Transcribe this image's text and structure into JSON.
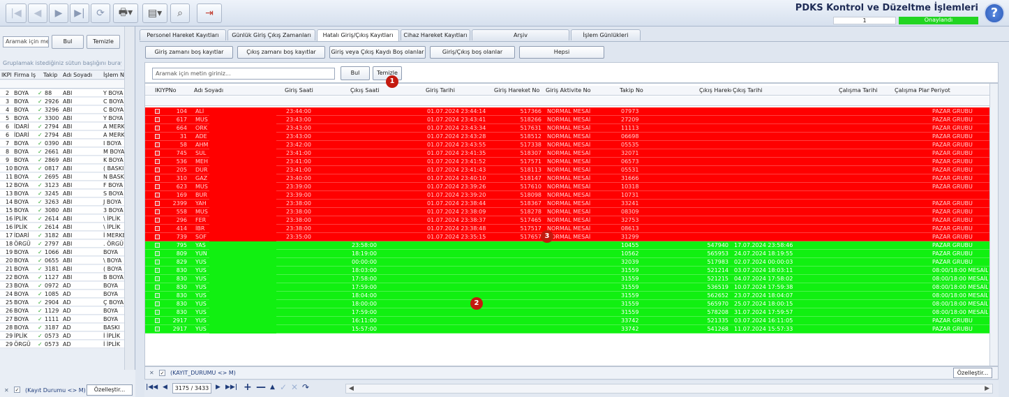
{
  "app": {
    "title": "PDKS Kontrol ve Düzeltme İşlemleri",
    "status_number": "1",
    "status_label": "Onaylandı"
  },
  "toolbar": {
    "icons": [
      "first-icon",
      "prev-icon",
      "next-icon",
      "last-icon",
      "refresh-icon",
      "print-icon",
      "export-icon",
      "preview-icon",
      "exit-icon"
    ]
  },
  "left_panel": {
    "search_placeholder": "Aramak için me",
    "find_label": "Bul",
    "clear_label": "Temizle",
    "group_hint": "Gruplamak istediğiniz sütun başlığını buraya sü",
    "columns": [
      "IKPl",
      "Firma Iş",
      "Takip",
      "Adı Soyadı",
      "İşlem Nı"
    ],
    "rows": [
      [
        "2",
        "BOYA",
        "88",
        "ABI",
        "Y BOYA"
      ],
      [
        "3",
        "BOYA",
        "2926",
        "ABI",
        "C BOYA"
      ],
      [
        "4",
        "BOYA",
        "3296",
        "ABI",
        "C BOYA"
      ],
      [
        "5",
        "BOYA",
        "3300",
        "ABI",
        "Y BOYA"
      ],
      [
        "6",
        "İDARİ",
        "2794",
        "ABI",
        "A MERKEZ"
      ],
      [
        "6",
        "İDARİ",
        "2794",
        "ABI",
        "A MERKEZ"
      ],
      [
        "7",
        "BOYA",
        "0390",
        "ABI",
        "I BOYA"
      ],
      [
        "8",
        "BOYA",
        "2661",
        "ABI",
        "M BOYA"
      ],
      [
        "9",
        "BOYA",
        "2869",
        "ABI",
        "K BOYA"
      ],
      [
        "10",
        "BOYA",
        "0817",
        "ABI",
        "( BASKI"
      ],
      [
        "11",
        "BOYA",
        "2695",
        "ABI",
        "N BASKI"
      ],
      [
        "12",
        "BOYA",
        "3123",
        "ABI",
        "F BOYA"
      ],
      [
        "13",
        "BOYA",
        "3245",
        "ABI",
        "S BOYA"
      ],
      [
        "14",
        "BOYA",
        "3263",
        "ABI",
        "J BOYA"
      ],
      [
        "15",
        "BOYA",
        "3080",
        "ABI",
        "3 BOYA"
      ],
      [
        "16",
        "İPLİK",
        "2614",
        "ABI",
        "\\ İPLİK"
      ],
      [
        "16",
        "İPLİK",
        "2614",
        "ABI",
        "\\ İPLİK"
      ],
      [
        "17",
        "İDARİ",
        "3182",
        "ABI",
        "İ MERKEZ"
      ],
      [
        "18",
        "ÖRGÜ",
        "2797",
        "ABI",
        ". ÖRGÜ"
      ],
      [
        "19",
        "BOYA",
        "1066",
        "ABI",
        "BOYA"
      ],
      [
        "20",
        "BOYA",
        "0655",
        "ABI",
        "\\ BOYA"
      ],
      [
        "21",
        "BOYA",
        "3181",
        "ABI",
        "( BOYA"
      ],
      [
        "22",
        "BOYA",
        "1127",
        "ABI",
        "B BOYA"
      ],
      [
        "23",
        "BOYA",
        "0972",
        "AD",
        "BOYA"
      ],
      [
        "24",
        "BOYA",
        "1085",
        "AD",
        "BOYA"
      ],
      [
        "25",
        "BOYA",
        "2904",
        "AD",
        "Ç BOYA"
      ],
      [
        "26",
        "BOYA",
        "1129",
        "AD",
        "BOYA"
      ],
      [
        "27",
        "BOYA",
        "1111",
        "AD",
        "BOYA"
      ],
      [
        "28",
        "BOYA",
        "3187",
        "AD",
        "BASKI"
      ],
      [
        "29",
        "İPLİK",
        "0573",
        "AD",
        "İ İPLİK"
      ],
      [
        "29",
        "ÖRGÜ",
        "0573",
        "AD",
        "İ İPLİK"
      ]
    ],
    "footer_filter": "(Kayıt Durumu <> M)",
    "customize_label": "Özelleştir..."
  },
  "tabs": [
    "Personel Hareket Kayıtları",
    "Günlük Giriş Çıkış Zamanları",
    "Hatalı Giriş/Çıkış Kayıtları",
    "Cihaz Hareket Kayıtları",
    "Arşiv",
    "İşlem Günlükleri"
  ],
  "filter_buttons": [
    "Giriş zamanı boş kayıtlar",
    "Çıkış zamanı boş kayıtlar",
    "Giriş veya Çıkış Kaydı Boş olanlar",
    "Giriş/Çıkış boş olanlar",
    "Hepsi"
  ],
  "search": {
    "placeholder": "Aramak için metin giriniz...",
    "find_label": "Bul",
    "clear_label": "Temizle"
  },
  "grid": {
    "columns": [
      "IKIYPNo",
      "Adı Soyadı",
      "Giriş Saati",
      "Çıkış Saati",
      "Giriş Tarihi",
      "Giriş Hareket No",
      "Giriş Aktivite No",
      "Takip No",
      "Çıkış Hareke",
      "Çıkış Tarihi",
      "Çalışma Tarihi",
      "Çalışma Plan",
      "Periyot"
    ],
    "red_rows": [
      [
        "104",
        "ALİ",
        "23:44:00",
        "",
        "01.07.2024 23:44:14",
        "517366",
        "NORMAL MESAİ",
        "07973",
        "",
        "",
        "",
        "",
        "PAZAR GRUBU"
      ],
      [
        "617",
        "MUS",
        "23:43:00",
        "",
        "01.07.2024 23:43:41",
        "518266",
        "NORMAL MESAİ",
        "27209",
        "",
        "",
        "",
        "",
        "PAZAR GRUBU"
      ],
      [
        "664",
        "ORK",
        "23:43:00",
        "",
        "01.07.2024 23:43:34",
        "517631",
        "NORMAL MESAİ",
        "11113",
        "",
        "",
        "",
        "",
        "PAZAR GRUBU"
      ],
      [
        "31",
        "ADE",
        "23:43:00",
        "",
        "01.07.2024 23:43:28",
        "518512",
        "NORMAL MESAİ",
        "06698",
        "",
        "",
        "",
        "",
        "PAZAR GRUBU"
      ],
      [
        "58",
        "AHM",
        "23:42:00",
        "",
        "01.07.2024 23:43:55",
        "517338",
        "NORMAL MESAİ",
        "05535",
        "",
        "",
        "",
        "",
        "PAZAR GRUBU"
      ],
      [
        "745",
        "SUL",
        "23:41:00",
        "",
        "01.07.2024 23:41:35",
        "518307",
        "NORMAL MESAİ",
        "32071",
        "",
        "",
        "",
        "",
        "PAZAR GRUBU"
      ],
      [
        "536",
        "MEH",
        "23:41:00",
        "",
        "01.07.2024 23:41:52",
        "517571",
        "NORMAL MESAİ",
        "06573",
        "",
        "",
        "",
        "",
        "PAZAR GRUBU"
      ],
      [
        "205",
        "DUR",
        "23:41:00",
        "",
        "01.07.2024 23:41:43",
        "518113",
        "NORMAL MESAİ",
        "05531",
        "",
        "",
        "",
        "",
        "PAZAR GRUBU"
      ],
      [
        "310",
        "GAZ",
        "23:40:00",
        "",
        "01.07.2024 23:40:10",
        "518147",
        "NORMAL MESAİ",
        "31666",
        "",
        "",
        "",
        "",
        "PAZAR GRUBU"
      ],
      [
        "623",
        "MUS",
        "23:39:00",
        "",
        "01.07.2024 23:39:26",
        "517610",
        "NORMAL MESAİ",
        "10318",
        "",
        "",
        "",
        "",
        "PAZAR GRUBU"
      ],
      [
        "169",
        "BUR",
        "23:39:00",
        "",
        "01.07.2024 23:39:20",
        "518098",
        "NORMAL MESAİ",
        "10731",
        "",
        "",
        "",
        "",
        ""
      ],
      [
        "2399",
        "YAH",
        "23:38:00",
        "",
        "01.07.2024 23:38:44",
        "518367",
        "NORMAL MESAİ",
        "33241",
        "",
        "",
        "",
        "",
        "PAZAR GRUBU"
      ],
      [
        "558",
        "MUS",
        "23:38:00",
        "",
        "01.07.2024 23:38:09",
        "518278",
        "NORMAL MESAİ",
        "08309",
        "",
        "",
        "",
        "",
        "PAZAR GRUBU"
      ],
      [
        "296",
        "FER",
        "23:38:00",
        "",
        "01.07.2024 23:38:37",
        "517465",
        "NORMAL MESAİ",
        "32753",
        "",
        "",
        "",
        "",
        "PAZAR GRUBU"
      ],
      [
        "414",
        "İBR",
        "23:38:00",
        "",
        "01.07.2024 23:38:48",
        "517517",
        "NORMAL MESAİ",
        "08613",
        "",
        "",
        "",
        "",
        "PAZAR GRUBU"
      ],
      [
        "739",
        "SOF",
        "23:35:00",
        "",
        "01.07.2024 23:35:15",
        "517657",
        "NORMAL MESAİ",
        "31299",
        "",
        "",
        "",
        "",
        "PAZAR GRUBU"
      ]
    ],
    "green_rows": [
      [
        "795",
        "YAS",
        "",
        "23:58:00",
        "",
        "",
        "",
        "10455",
        "547940",
        "17.07.2024 23:58:46",
        "",
        "",
        "PAZAR GRUBU"
      ],
      [
        "809",
        "YUN",
        "",
        "18:19:00",
        "",
        "",
        "",
        "10562",
        "565953",
        "24.07.2024 18:19:55",
        "",
        "",
        "PAZAR GRUBU"
      ],
      [
        "829",
        "YUS",
        "",
        "00:00:00",
        "",
        "",
        "",
        "32039",
        "517983",
        "02.07.2024 00:00:03",
        "",
        "",
        "PAZAR GRUBU"
      ],
      [
        "830",
        "YUS",
        "",
        "18:03:00",
        "",
        "",
        "",
        "31559",
        "521214",
        "03.07.2024 18:03:11",
        "",
        "",
        "08:00/18:00 MESAİLİ"
      ],
      [
        "830",
        "YUS",
        "",
        "17:58:00",
        "",
        "",
        "",
        "31559",
        "521215",
        "04.07.2024 17:58:02",
        "",
        "",
        "08:00/18:00 MESAİLİ"
      ],
      [
        "830",
        "YUS",
        "",
        "17:59:00",
        "",
        "",
        "",
        "31559",
        "536519",
        "10.07.2024 17:59:38",
        "",
        "",
        "08:00/18:00 MESAİLİ"
      ],
      [
        "830",
        "YUS",
        "",
        "18:04:00",
        "",
        "",
        "",
        "31559",
        "562652",
        "23.07.2024 18:04:07",
        "",
        "",
        "08:00/18:00 MESAİLİ"
      ],
      [
        "830",
        "YUS",
        "",
        "18:00:00",
        "",
        "",
        "",
        "31559",
        "565970",
        "25.07.2024 18:00:15",
        "",
        "",
        "08:00/18:00 MESAİLİ"
      ],
      [
        "830",
        "YUS",
        "",
        "17:59:00",
        "",
        "",
        "",
        "31559",
        "578208",
        "31.07.2024 17:59:57",
        "",
        "",
        "08:00/18:00 MESAİLİ"
      ],
      [
        "2917",
        "YUS",
        "",
        "16:11:00",
        "",
        "",
        "",
        "33742",
        "521335",
        "03.07.2024 16:11:05",
        "",
        "",
        "PAZAR GRUBU"
      ],
      [
        "2917",
        "YUS",
        "",
        "15:57:00",
        "",
        "",
        "",
        "33742",
        "541268",
        "11.07.2024 15:57:33",
        "",
        "",
        "PAZAR GRUBU"
      ]
    ],
    "filter_text": "(KAYIT_DURUMU <> M)",
    "customize_label": "Özelleştir..."
  },
  "navigator": {
    "position": "3175 / 3433"
  },
  "annotations": [
    "1",
    "2",
    "3"
  ],
  "colors": {
    "error_red": "#ff0000",
    "ok_green": "#11f011",
    "approved": "#22d522"
  }
}
